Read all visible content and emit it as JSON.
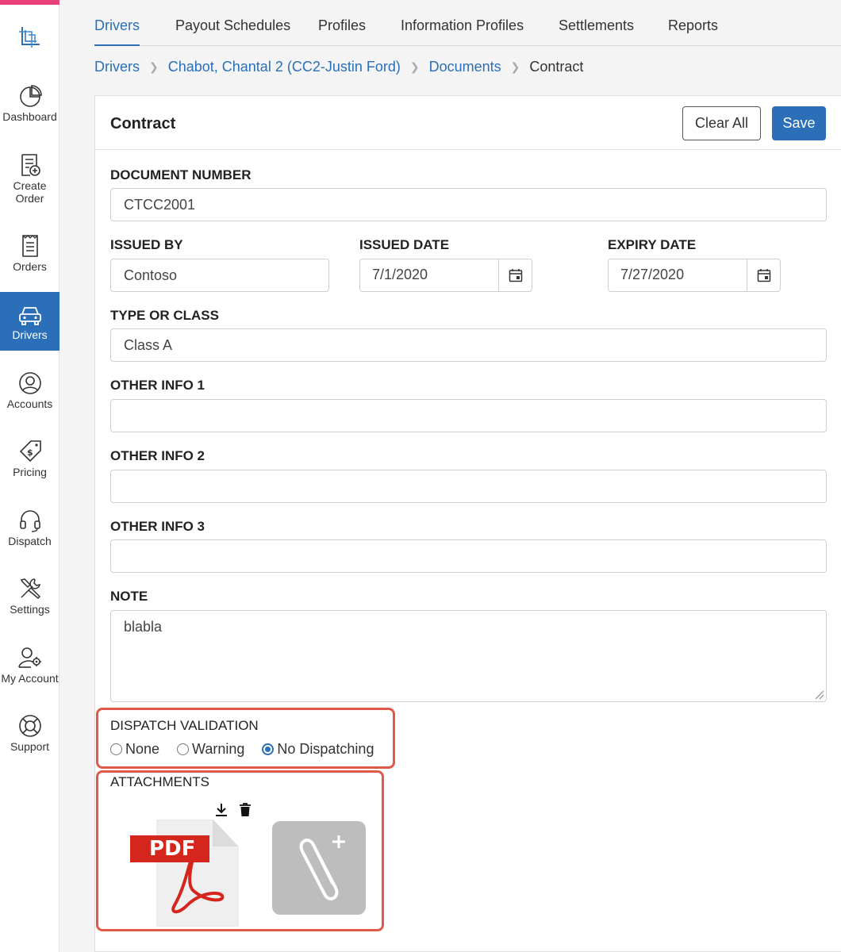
{
  "sidebar": {
    "items": [
      {
        "label": "Dashboard",
        "icon": "dashboard-icon"
      },
      {
        "label": "Create Order",
        "icon": "create-order-icon"
      },
      {
        "label": "Orders",
        "icon": "orders-icon"
      },
      {
        "label": "Drivers",
        "icon": "car-icon",
        "active": true
      },
      {
        "label": "Accounts",
        "icon": "user-circle-icon"
      },
      {
        "label": "Pricing",
        "icon": "price-tag-icon"
      },
      {
        "label": "Dispatch",
        "icon": "headset-icon"
      },
      {
        "label": "Settings",
        "icon": "tools-icon"
      },
      {
        "label": "My Account",
        "icon": "user-gear-icon"
      },
      {
        "label": "Support",
        "icon": "lifebuoy-icon"
      }
    ]
  },
  "tabs": [
    "Drivers",
    "Payout Schedules",
    "Profiles",
    "Information Profiles",
    "Settlements",
    "Reports"
  ],
  "breadcrumb": {
    "links": [
      "Drivers",
      "Chabot, Chantal 2 (CC2-Justin Ford)",
      "Documents"
    ],
    "current": "Contract"
  },
  "card": {
    "title": "Contract",
    "clear_label": "Clear All",
    "save_label": "Save"
  },
  "form": {
    "document_number": {
      "label": "DOCUMENT NUMBER",
      "value": "CTCC2001"
    },
    "issued_by": {
      "label": "ISSUED BY",
      "value": "Contoso"
    },
    "issued_date": {
      "label": "ISSUED DATE",
      "value": "7/1/2020"
    },
    "expiry_date": {
      "label": "EXPIRY DATE",
      "value": "7/27/2020"
    },
    "type_or_class": {
      "label": "TYPE OR CLASS",
      "value": "Class A"
    },
    "other_info_1": {
      "label": "OTHER INFO 1",
      "value": ""
    },
    "other_info_2": {
      "label": "OTHER INFO 2",
      "value": ""
    },
    "other_info_3": {
      "label": "OTHER INFO 3",
      "value": ""
    },
    "note": {
      "label": "NOTE",
      "value": "blabla"
    }
  },
  "dispatch_validation": {
    "label": "DISPATCH VALIDATION",
    "options": [
      "None",
      "Warning",
      "No Dispatching"
    ],
    "selected": "No Dispatching"
  },
  "attachments": {
    "label": "ATTACHMENTS",
    "pdf_badge": "PDF"
  },
  "colors": {
    "accent": "#2a6fb8",
    "highlight": "#e05a4a",
    "pdf_red": "#d4261c"
  }
}
